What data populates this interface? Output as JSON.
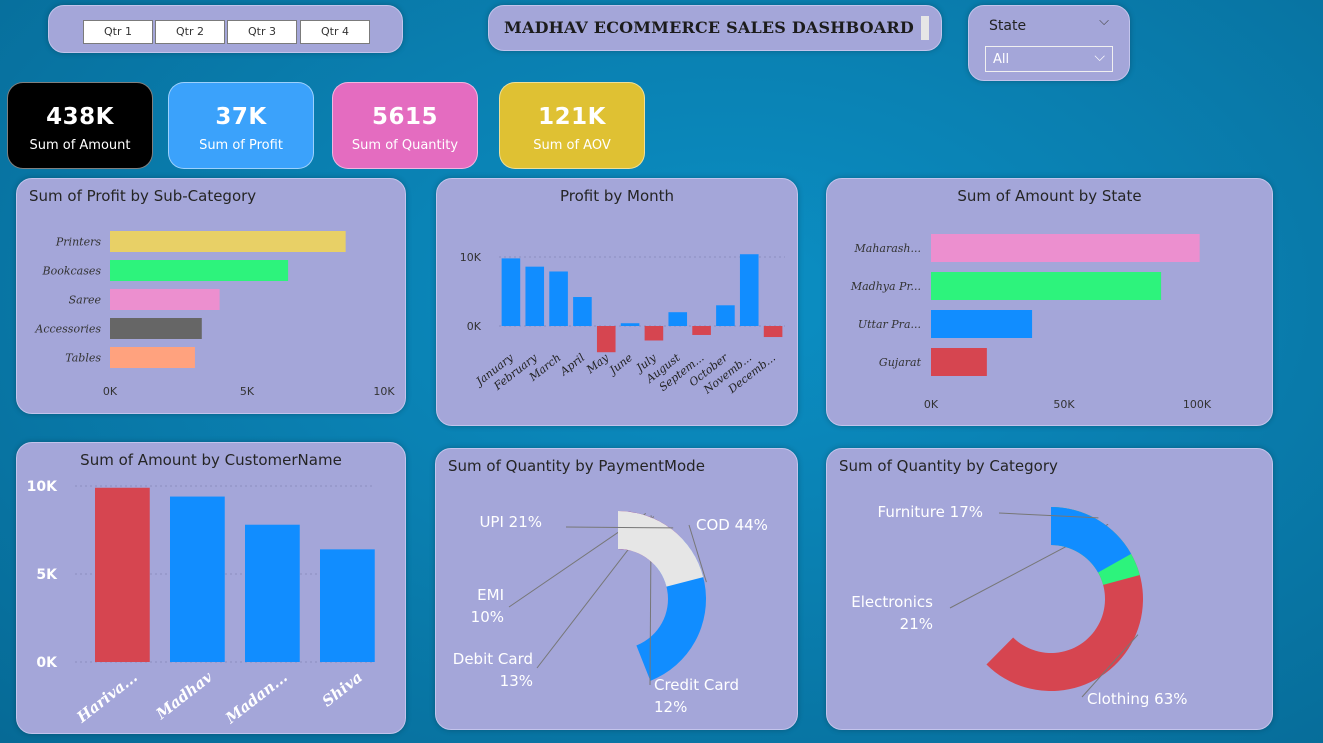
{
  "slicer": {
    "quarters": [
      "Qtr 1",
      "Qtr 2",
      "Qtr 3",
      "Qtr 4"
    ]
  },
  "dashboard_title": "MADHAV ECOMMERCE SALES DASHBOARD",
  "state_filter": {
    "label": "State",
    "selected": "All"
  },
  "kpis": [
    {
      "value": "438K",
      "caption": "Sum of Amount",
      "color": "#000000"
    },
    {
      "value": "37K",
      "caption": "Sum of Profit",
      "color": "#3ba2fb"
    },
    {
      "value": "5615",
      "caption": "Sum of Quantity",
      "color": "#e46cc0"
    },
    {
      "value": "121K",
      "caption": "Sum of AOV",
      "color": "#dfc133"
    }
  ],
  "chart_data": [
    {
      "id": "profit-by-subcategory",
      "type": "bar",
      "orientation": "horizontal",
      "title": "Sum of Profit by Sub-Category",
      "categories": [
        "Printers",
        "Bookcases",
        "Saree",
        "Accessories",
        "Tables"
      ],
      "values": [
        8600,
        6500,
        4000,
        3350,
        3100
      ],
      "colors": [
        "#e8d066",
        "#2df37c",
        "#ec8fcf",
        "#666666",
        "#ffa27e"
      ],
      "xlim": [
        0,
        10000
      ],
      "xticks": [
        "0K",
        "5K",
        "10K"
      ]
    },
    {
      "id": "profit-by-month",
      "type": "bar",
      "title": "Profit by Month",
      "categories": [
        "January",
        "February",
        "March",
        "April",
        "May",
        "June",
        "July",
        "August",
        "Septem...",
        "October",
        "Novemb...",
        "Decemb..."
      ],
      "values": [
        9800,
        8600,
        7900,
        4200,
        -3800,
        400,
        -2100,
        2000,
        -1300,
        3000,
        10400,
        -1600
      ],
      "yticks": [
        "10K",
        "0K"
      ],
      "ylim": [
        -4000,
        11000
      ],
      "colors": {
        "positive": "#118dff",
        "negative": "#d64550"
      }
    },
    {
      "id": "amount-by-state",
      "type": "bar",
      "orientation": "horizontal",
      "title": "Sum of Amount by State",
      "categories": [
        "Maharash...",
        "Madhya Pr...",
        "Uttar Pra...",
        "Gujarat"
      ],
      "values": [
        101000,
        86500,
        38000,
        21000
      ],
      "colors": [
        "#ec8fcf",
        "#2df37c",
        "#118dff",
        "#d64550"
      ],
      "xlim": [
        0,
        100000
      ],
      "xticks": [
        "0K",
        "50K",
        "100K"
      ]
    },
    {
      "id": "amount-by-customer",
      "type": "bar",
      "title": "Sum of Amount by CustomerName",
      "categories": [
        "Hariva...",
        "Madhav",
        "Madan...",
        "Shiva"
      ],
      "values": [
        9900,
        9400,
        7800,
        6400
      ],
      "colors": [
        "#d64550",
        "#118dff",
        "#118dff",
        "#118dff"
      ],
      "ylim": [
        0,
        10000
      ],
      "yticks": [
        "10K",
        "5K",
        "0K"
      ]
    },
    {
      "id": "quantity-by-paymentmode",
      "type": "pie",
      "donut": true,
      "title": "Sum of Quantity by PaymentMode",
      "slices": [
        {
          "label": "COD",
          "pct": 44,
          "text": "COD 44%",
          "color": "#118dff"
        },
        {
          "label": "Credit Card",
          "pct": 12,
          "text": "Credit Card 12%",
          "color": "#e66c37"
        },
        {
          "label": "Debit Card",
          "pct": 13,
          "text": "Debit Card 13%",
          "color": "#ec8fcf"
        },
        {
          "label": "EMI",
          "pct": 10,
          "text": "EMI 10%",
          "color": "#6b007b"
        },
        {
          "label": "UPI",
          "pct": 21,
          "text": "UPI 21%",
          "color": "#e6e6e6"
        }
      ]
    },
    {
      "id": "quantity-by-category",
      "type": "pie",
      "donut": true,
      "title": "Sum of Quantity by Category",
      "slices": [
        {
          "label": "Clothing",
          "pct": 63,
          "text": "Clothing 63%",
          "color": "#d64550"
        },
        {
          "label": "Electronics",
          "pct": 21,
          "text": "Electronics 21%",
          "color": "#2df37c"
        },
        {
          "label": "Furniture",
          "pct": 17,
          "text": "Furniture 17%",
          "color": "#118dff"
        }
      ]
    }
  ]
}
